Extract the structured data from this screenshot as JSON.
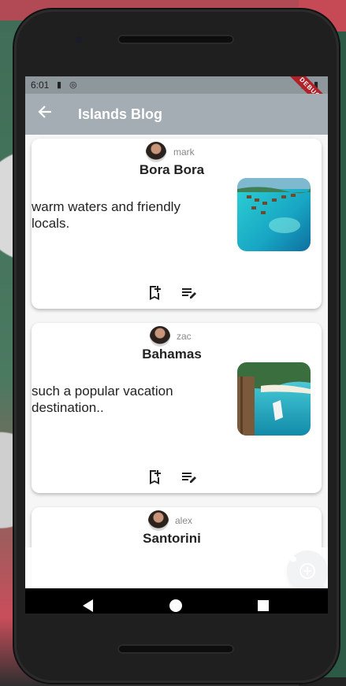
{
  "status": {
    "time": "6:01"
  },
  "debug_banner": "DEBUG",
  "appbar": {
    "title": "Islands Blog"
  },
  "posts": [
    {
      "author": "mark",
      "title": "Bora Bora",
      "body": "warm waters and friendly locals."
    },
    {
      "author": "zac",
      "title": "Bahamas",
      "body": " such a popular vacation destination.."
    },
    {
      "author": "alex",
      "title": "Santorini",
      "body": ""
    }
  ],
  "bottom_nav": {
    "items": [
      {
        "label": "Home"
      }
    ]
  },
  "colors": {
    "appbar": "#a3adb3",
    "statusbar": "#8e979c",
    "fab": "#a3adb3"
  }
}
